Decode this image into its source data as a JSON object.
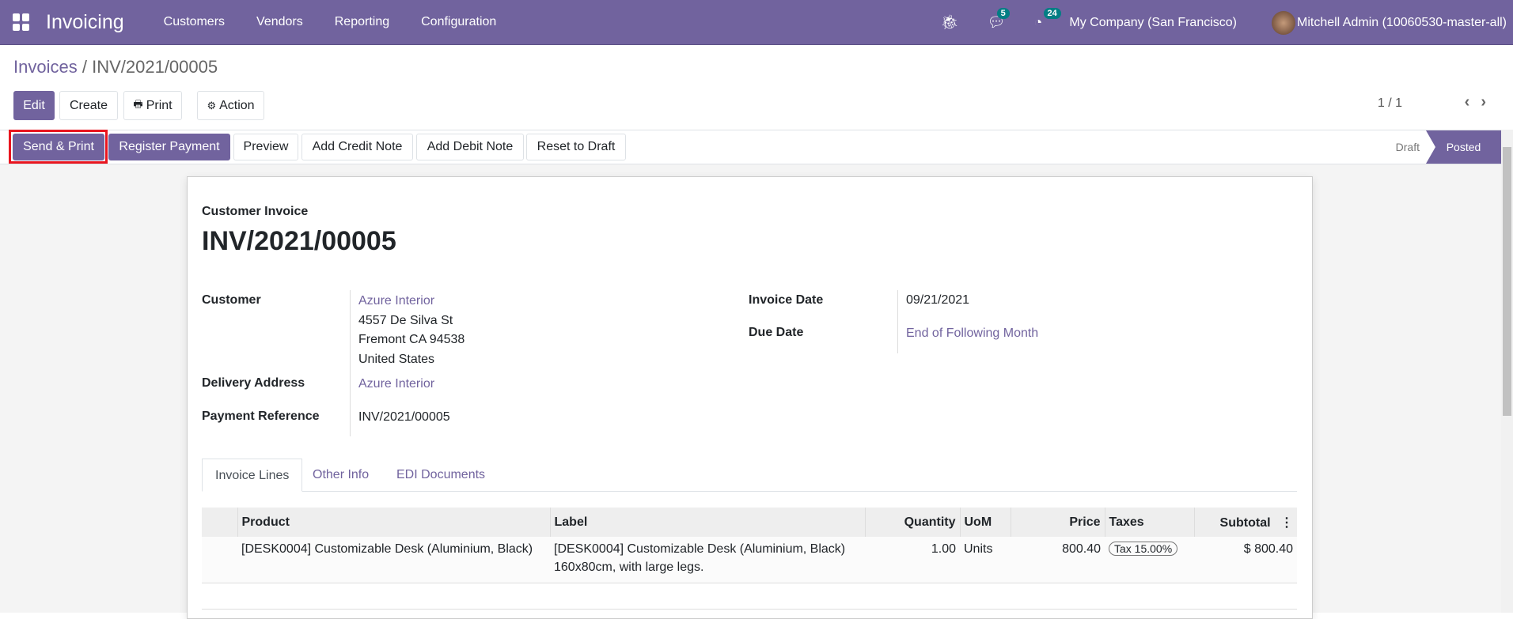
{
  "nav": {
    "app": "Invoicing",
    "menus": [
      "Customers",
      "Vendors",
      "Reporting",
      "Configuration"
    ],
    "messages_count": "5",
    "activities_count": "24",
    "company": "My Company (San Francisco)",
    "user": "Mitchell Admin (10060530-master-all)"
  },
  "breadcrumb": {
    "parent": "Invoices",
    "sep": "/",
    "current": "INV/2021/00005"
  },
  "toolbar": {
    "edit": "Edit",
    "create": "Create",
    "print": "Print",
    "action": "Action",
    "pager": "1 / 1",
    "prev": "‹",
    "next": "›"
  },
  "header_buttons": {
    "send_print": "Send & Print",
    "register_payment": "Register Payment",
    "preview": "Preview",
    "add_credit_note": "Add Credit Note",
    "add_debit_note": "Add Debit Note",
    "reset_to_draft": "Reset to Draft"
  },
  "status": {
    "stages": [
      "Draft",
      "Posted"
    ],
    "current": "Posted"
  },
  "invoice": {
    "type": "Customer Invoice",
    "number": "INV/2021/00005",
    "customer_label": "Customer",
    "customer": "Azure Interior",
    "address": [
      "4557 De Silva St",
      "Fremont CA 94538",
      "United States"
    ],
    "delivery_label": "Delivery Address",
    "delivery": "Azure Interior",
    "payref_label": "Payment Reference",
    "payref": "INV/2021/00005",
    "invoice_date_label": "Invoice Date",
    "invoice_date": "09/21/2021",
    "due_date_label": "Due Date",
    "due_date": "End of Following Month"
  },
  "tabs": [
    "Invoice Lines",
    "Other Info",
    "EDI Documents"
  ],
  "lines": {
    "headers": [
      "Product",
      "Label",
      "Quantity",
      "UoM",
      "Price",
      "Taxes",
      "Subtotal"
    ],
    "rows": [
      {
        "product": "[DESK0004] Customizable Desk (Aluminium, Black)",
        "label1": "[DESK0004] Customizable Desk (Aluminium, Black)",
        "label2": "160x80cm, with large legs.",
        "quantity": "1.00",
        "uom": "Units",
        "price": "800.40",
        "taxes": "Tax 15.00%",
        "subtotal": "$ 800.40"
      }
    ]
  },
  "colors": {
    "brand": "#71639e",
    "badge": "#017e84",
    "highlight": "#e8151f"
  }
}
